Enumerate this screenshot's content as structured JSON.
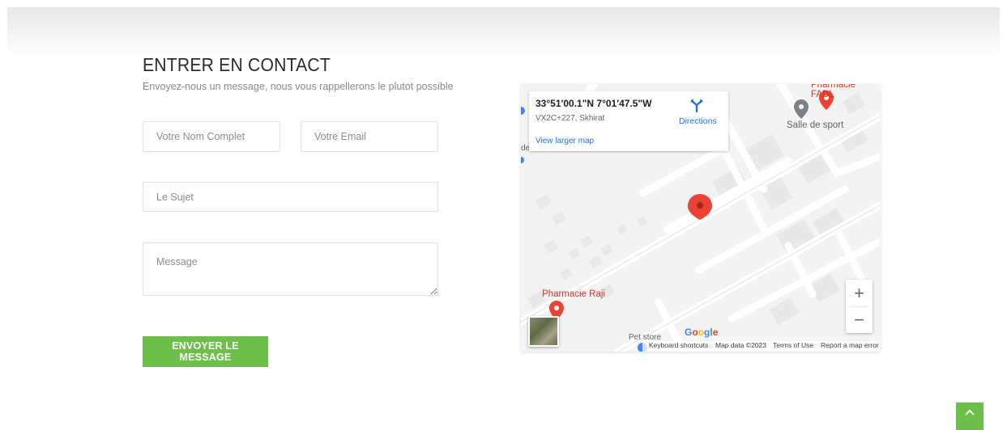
{
  "contact": {
    "title": "ENTRER EN CONTACT",
    "subtitle": "Envoyez-nous un message, nous vous rappellerons le plutot possible",
    "name_placeholder": "Votre Nom Complet",
    "email_placeholder": "Votre Email",
    "subject_placeholder": "Le Sujet",
    "message_placeholder": "Message",
    "submit_label": "ENVOYER LE MESSAGE"
  },
  "map": {
    "coordinates": "33°51'00.1\"N 7°01'47.5\"W",
    "plus_code": "VX2C+227, Skhirat",
    "directions_label": "Directions",
    "larger_map_label": "View larger map",
    "poi_pharmacie_fadl": "Pharmacie FADL",
    "poi_salle_sport": "Salle de sport",
    "poi_pharmacie_raji": "Pharmacie Raji",
    "poi_pet_store": "Pet store",
    "side_letters": "de",
    "google_logo": "Google",
    "zoom_in": "+",
    "zoom_out": "−",
    "footer": {
      "keyboard": "Keyboard shortcuts",
      "map_data": "Map data ©2023",
      "terms": "Terms of Use",
      "report": "Report a map error"
    },
    "colors": {
      "background": "#f3f3f3",
      "street": "#ffffff",
      "building": "#e8e8e8",
      "marker": "#ea4335",
      "poi_pharmacy": "#d93025",
      "poi_gym": "#5f6368",
      "link": "#1a73e8"
    }
  },
  "scroll_top": {
    "icon": "chevron-up-icon"
  },
  "theme": {
    "accent": "#6cc04a"
  }
}
